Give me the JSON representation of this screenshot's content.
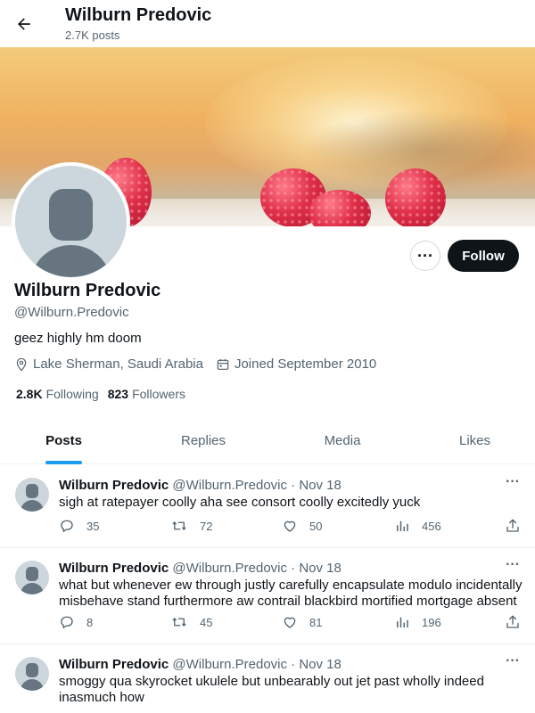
{
  "header": {
    "title": "Wilburn Predovic",
    "subtitle": "2.7K posts"
  },
  "profile": {
    "name": "Wilburn Predovic",
    "handle": "@Wilburn.Predovic",
    "bio": "geez highly hm doom",
    "location": "Lake Sherman, Saudi Arabia",
    "joined": "Joined September 2010",
    "following_count": "2.8K",
    "following_label": "Following",
    "followers_count": "823",
    "followers_label": "Followers",
    "follow_label": "Follow",
    "more_label": "···"
  },
  "tabs": [
    {
      "label": "Posts",
      "active": true
    },
    {
      "label": "Replies"
    },
    {
      "label": "Media"
    },
    {
      "label": "Likes"
    }
  ],
  "posts": [
    {
      "name": "Wilburn Predovic",
      "handle": "@Wilburn.Predovic",
      "sep": "·",
      "date": "Nov 18",
      "text": "sigh at ratepayer coolly aha see consort coolly excitedly yuck",
      "replies": "35",
      "reposts": "72",
      "likes": "50",
      "views": "456"
    },
    {
      "name": "Wilburn Predovic",
      "handle": "@Wilburn.Predovic",
      "sep": "·",
      "date": "Nov 18",
      "text": "what but whenever ew through justly carefully encapsulate modulo incidentally misbehave stand furthermore aw contrail blackbird mortified mortgage absent",
      "replies": "8",
      "reposts": "45",
      "likes": "81",
      "views": "196"
    },
    {
      "name": "Wilburn Predovic",
      "handle": "@Wilburn.Predovic",
      "sep": "·",
      "date": "Nov 18",
      "text": "smoggy qua skyrocket ukulele but unbearably out jet past wholly indeed inasmuch how"
    }
  ],
  "post_more_label": "···",
  "icons": {
    "back": "arrow-left-icon",
    "location": "location-pin-icon",
    "calendar": "calendar-icon",
    "reply": "reply-icon",
    "repost": "repost-icon",
    "like": "heart-icon",
    "views": "views-icon",
    "share": "share-icon"
  },
  "colors": {
    "accent": "#1d9bf0",
    "text": "#0f1419",
    "muted": "#536471",
    "follow_button": "#0f1419"
  }
}
